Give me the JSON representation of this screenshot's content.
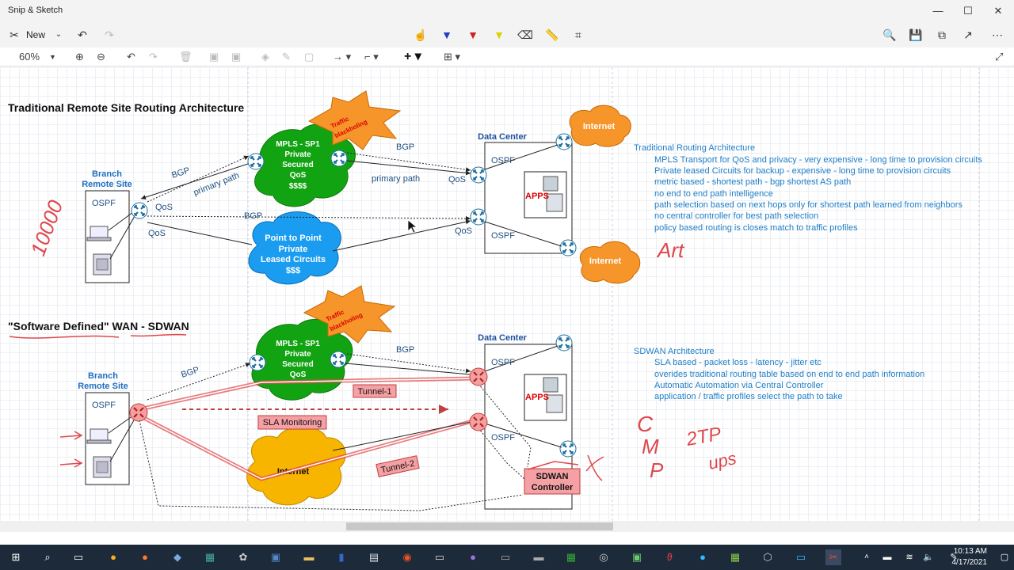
{
  "app": {
    "title": "Snip & Sketch"
  },
  "window_controls": {
    "minimize": "—",
    "maximize": "☐",
    "close": "✕"
  },
  "toolbar": {
    "new_label": "New"
  },
  "drawbar": {
    "zoom": "60%"
  },
  "diagram1": {
    "title": "Traditional Remote Site Routing Architecture",
    "branch_label_1": "Branch",
    "branch_label_2": "Remote Site",
    "branch_ospf": "OSPF",
    "mpls_lines": [
      "MPLS - SP1",
      "Private",
      "Secured",
      "QoS",
      "$$$$"
    ],
    "p2p_lines": [
      "Point to Point",
      "Private",
      "Leased Circuits",
      "$$$"
    ],
    "blackholing_lines": [
      "Traffic",
      "blackholing"
    ],
    "datacenter": "Data Center",
    "dc_ospf_top": "OSPF",
    "dc_ospf_bottom": "OSPF",
    "apps": "APPS",
    "internet_top": "Internet",
    "internet_bottom": "Internet",
    "bgp_left": "BGP",
    "bgp_right": "BGP",
    "bgp_middle": "BGP",
    "primary_path_left": "primary path",
    "primary_path_right": "primary path",
    "qos_branch_top": "QoS",
    "qos_branch_bottom": "QoS",
    "qos_dc_top": "QoS",
    "qos_dc_bottom": "QoS",
    "notes_title": "Traditional Routing Architecture",
    "notes": [
      "MPLS Transport for QoS and privacy - very expensive - long time to provision circuits",
      "Private leased Circuits for backup - expensive - long time to provision circuits",
      "metric based - shortest path - bgp shortest AS path",
      "no end to end path intelligence",
      "path selection based on next hops only for shortest path learned from neighbors",
      "no central controller for best path selection",
      "policy based routing is closes match to traffic profiles"
    ],
    "handwriting_left": "10000",
    "handwriting_right": "Art"
  },
  "diagram2": {
    "title": "\"Software Defined\"  WAN - SDWAN",
    "branch_label_1": "Branch",
    "branch_label_2": "Remote Site",
    "branch_ospf": "OSPF",
    "mpls_lines": [
      "MPLS - SP1",
      "Private",
      "Secured",
      "QoS"
    ],
    "internet": "Internet",
    "blackholing_lines": [
      "Traffic",
      "blackholing"
    ],
    "datacenter": "Data Center",
    "dc_ospf_top": "OSPF",
    "dc_ospf_bottom": "OSPF",
    "apps": "APPS",
    "bgp_left": "BGP",
    "bgp_right": "BGP",
    "tunnel1": "Tunnel-1",
    "tunnel2": "Tunnel-2",
    "sla": "SLA Monitoring",
    "controller_lines": [
      "SDWAN",
      "Controller"
    ],
    "notes_title": "SDWAN Architecture",
    "notes": [
      "SLA based - packet loss - latency - jitter etc",
      "overides traditional routing table based on end to end path information",
      "Automatic Automation via Central Controller",
      "application / traffic profiles select the path to take"
    ],
    "handwriting_lines": [
      "C",
      "M",
      "2TP",
      "P",
      "ups"
    ]
  },
  "taskbar": {
    "time": "10:13 AM",
    "date": "4/17/2021"
  },
  "colors": {
    "accent_blue": "#1f6fbf",
    "mpls_green": "#12a312",
    "cloud_orange": "#f5952a",
    "cloud_blue": "#1a9cf0",
    "internet_yellow": "#f7b500",
    "tunnel_red": "#e0474c",
    "handwriting": "#e0474c"
  }
}
